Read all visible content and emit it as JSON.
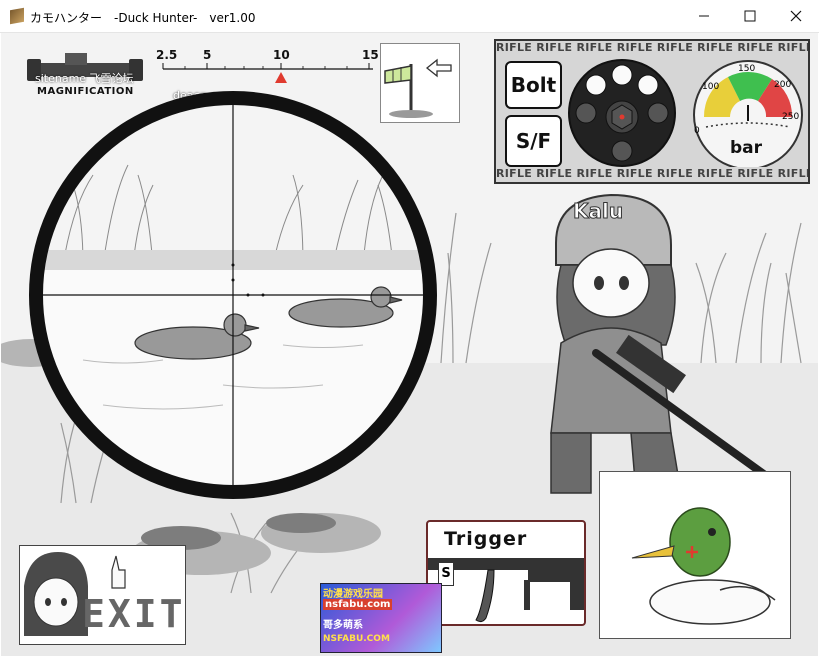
{
  "window": {
    "title": "カモハンター　-Duck Hunter-　ver1.00",
    "minimize_icon": "minimize-icon",
    "maximize_icon": "maximize-icon",
    "close_icon": "close-icon"
  },
  "magnification": {
    "label": "MAGNIFICATION",
    "ticks": [
      "2.5",
      "5",
      "10",
      "15"
    ],
    "current": 10
  },
  "watermarks": {
    "line1": "sitename 飞雪论坛",
    "line2": "deacg.org"
  },
  "wind": {
    "icon": "windsock-icon",
    "arrow": "arrow-left-icon"
  },
  "rifle_panel": {
    "strip_text": "RIFLE RIFLE RIFLE RIFLE RIFLE RIFLE RIFLE RIFLE RIF",
    "bolt_label": "Bolt",
    "sf_label": "S/F",
    "rounds_total": 6,
    "rounds_loaded": 3,
    "gauge": {
      "unit": "bar",
      "ticks": [
        "0",
        "100",
        "150",
        "200",
        "250"
      ],
      "colors": {
        "low": "#e8cf3a",
        "mid": "#3fbf4f",
        "high": "#e04545"
      }
    }
  },
  "trigger": {
    "label": "Trigger",
    "safety_letter": "S"
  },
  "exit": {
    "label": "EXIT"
  },
  "character": {
    "helmet_text": "Kalu"
  },
  "ad": {
    "line1": "动漫游戏乐园",
    "line2": "nsfabu.com",
    "line3": "哥多萌系",
    "line4": "NSFABU.COM"
  }
}
